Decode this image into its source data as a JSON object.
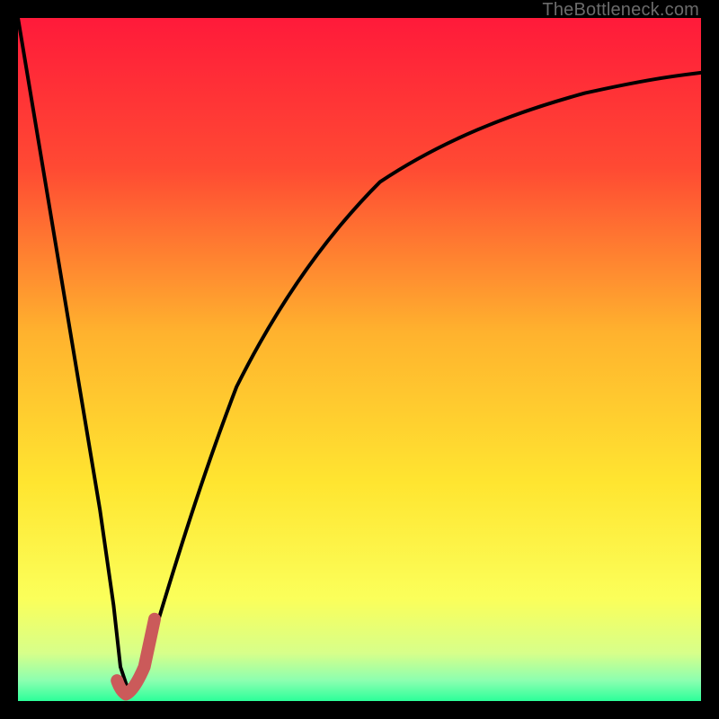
{
  "watermark": "TheBottleneck.com",
  "colors": {
    "frame": "#000000",
    "gradient_stops": [
      {
        "pct": 0,
        "color": "#ff1a3a"
      },
      {
        "pct": 22,
        "color": "#ff4a33"
      },
      {
        "pct": 46,
        "color": "#ffb22e"
      },
      {
        "pct": 68,
        "color": "#ffe530"
      },
      {
        "pct": 85,
        "color": "#fbff5a"
      },
      {
        "pct": 93,
        "color": "#d7ff8a"
      },
      {
        "pct": 97,
        "color": "#8cffb0"
      },
      {
        "pct": 100,
        "color": "#2cff9a"
      }
    ],
    "curve": "#000000",
    "accent_stroke": "#cb5a5a"
  },
  "chart_data": {
    "type": "line",
    "title": "",
    "xlabel": "",
    "ylabel": "",
    "xlim": [
      0,
      100
    ],
    "ylim": [
      0,
      100
    ],
    "grid": false,
    "legend": false,
    "series": [
      {
        "name": "bottleneck-curve",
        "x": [
          0,
          3,
          6,
          9,
          12,
          14,
          15,
          16,
          18,
          20,
          23,
          27,
          32,
          38,
          45,
          53,
          62,
          72,
          83,
          92,
          100
        ],
        "y": [
          100,
          82,
          64,
          46,
          28,
          14,
          5,
          2,
          4,
          10,
          20,
          33,
          46,
          58,
          68,
          76,
          82,
          86,
          89,
          91,
          92
        ]
      },
      {
        "name": "accent-hook",
        "x": [
          14.5,
          15.0,
          15.8,
          17.0,
          18.5,
          20.0
        ],
        "y": [
          3.0,
          1.5,
          1.0,
          1.5,
          5.0,
          12.0
        ]
      }
    ],
    "annotations": [
      {
        "text": "TheBottleneck.com",
        "role": "watermark",
        "position": "top-right"
      }
    ]
  }
}
